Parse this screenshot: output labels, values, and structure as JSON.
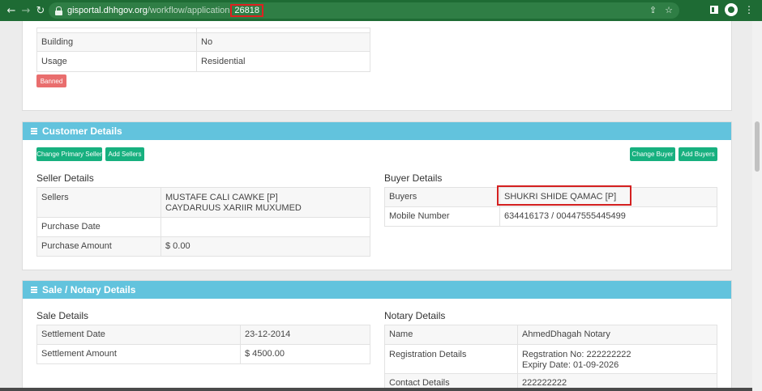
{
  "browser": {
    "url_host": "gisportal.dhhgov.org",
    "url_path": "/workflow/application",
    "url_id": "26818",
    "back_icon": "back-arrow-icon",
    "forward_icon": "forward-arrow-icon",
    "reload_icon": "reload-icon"
  },
  "property": {
    "rows": [
      {
        "label": "Building",
        "value": "No"
      },
      {
        "label": "Usage",
        "value": "Residential"
      }
    ],
    "status_badge": "Banned"
  },
  "customer": {
    "title": "Customer Details",
    "buttons": {
      "change_primary_seller": "Change Primary Seller",
      "add_sellers": "Add Sellers",
      "change_buyer": "Change Buyer",
      "add_buyers": "Add Buyers"
    },
    "seller": {
      "title": "Seller Details",
      "sellers_label": "Sellers",
      "sellers_line1": "MUSTAFE CALI CAWKE [P]",
      "sellers_line2": "CAYDARUUS XARIIR MUXUMED",
      "purchase_date_label": "Purchase Date",
      "purchase_date_value": "",
      "purchase_amount_label": "Purchase Amount",
      "purchase_amount_value": "$ 0.00"
    },
    "buyer": {
      "title": "Buyer Details",
      "buyers_label": "Buyers",
      "buyers_value": "SHUKRI SHIDE QAMAC [P]",
      "mobile_label": "Mobile Number",
      "mobile_value": "634416173 / 00447555445499"
    }
  },
  "sale": {
    "title": "Sale / Notary Details",
    "sale_details": {
      "title": "Sale Details",
      "settlement_date_label": "Settlement Date",
      "settlement_date_value": "23-12-2014",
      "settlement_amount_label": "Settlement Amount",
      "settlement_amount_value": "$ 4500.00"
    },
    "notary": {
      "title": "Notary Details",
      "name_label": "Name",
      "name_value": "AhmedDhagah Notary",
      "registration_label": "Registration Details",
      "registration_line1": "Regstration No: 222222222",
      "registration_line2": "Expiry Date: 01-09-2026",
      "contact_label": "Contact Details",
      "contact_value": "222222222"
    }
  },
  "colors": {
    "chrome": "#1e6b34",
    "panel_header": "#62c3dd",
    "button": "#17b07f",
    "banned": "#e96e6e",
    "highlight": "#d42020"
  }
}
